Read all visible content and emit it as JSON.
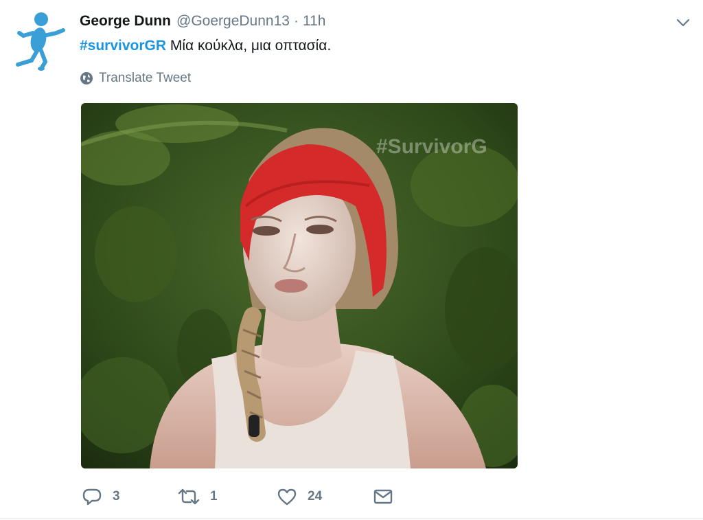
{
  "tweet": {
    "author_name": "George Dunn",
    "handle": "@GoergeDunn13",
    "separator": "·",
    "time": "11h",
    "hashtag": "#survivorGR",
    "text": " Μία κούκλα, μια οπτασία.",
    "translate_label": "Translate Tweet",
    "media_watermark": "#SurvivorG",
    "actions": {
      "reply_count": "3",
      "retweet_count": "1",
      "like_count": "24"
    }
  },
  "icons": {
    "avatar": "blue-stick-figure-avatar",
    "caret": "chevron-down-icon",
    "translate": "globe-icon",
    "reply": "reply-icon",
    "retweet": "retweet-icon",
    "like": "heart-icon",
    "dm": "envelope-icon"
  },
  "colors": {
    "link": "#1b95e0",
    "muted": "#657786",
    "avatar_blue": "#3a9fd6",
    "headband_red": "#d42a2a",
    "foliage": "#3d5a22"
  }
}
